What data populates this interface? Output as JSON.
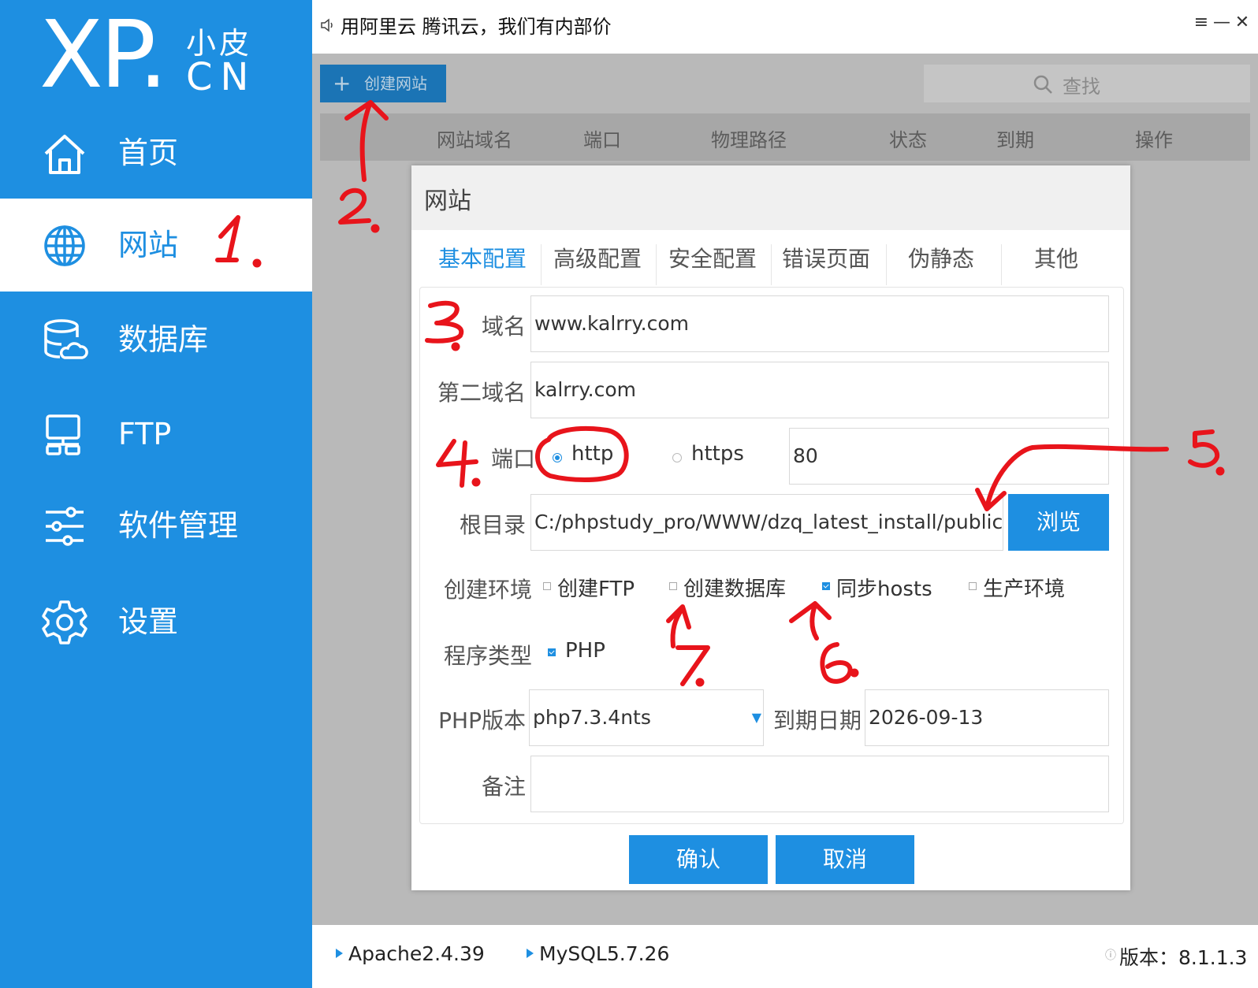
{
  "app": {
    "logo_big": "XP.",
    "logo_small_1": "小皮",
    "logo_small_2": "CN"
  },
  "sidebar": {
    "items": [
      {
        "label": "首页",
        "icon": "home-icon",
        "active": false
      },
      {
        "label": "网站",
        "icon": "globe-icon",
        "active": true
      },
      {
        "label": "数据库",
        "icon": "database-icon",
        "active": false
      },
      {
        "label": "FTP",
        "icon": "monitor-icon",
        "active": false
      },
      {
        "label": "软件管理",
        "icon": "sliders-icon",
        "active": false
      },
      {
        "label": "设置",
        "icon": "gear-icon",
        "active": false
      }
    ]
  },
  "topbar": {
    "notice": "用阿里云 腾讯云，我们有内部价",
    "menu_glyph": "≡",
    "minimize_glyph": "—",
    "close_glyph": "✕"
  },
  "toolbar": {
    "create_label": "创建网站",
    "search_label": "查找"
  },
  "table": {
    "columns": [
      "网站域名",
      "端口",
      "物理路径",
      "状态",
      "到期",
      "操作"
    ]
  },
  "dialog": {
    "title": "网站",
    "tabs": [
      "基本配置",
      "高级配置",
      "安全配置",
      "错误页面",
      "伪静态",
      "其他"
    ],
    "active_tab": "基本配置",
    "fields": {
      "domain_label": "域名",
      "domain_value": "www.kalrry.com",
      "second_domain_label": "第二域名",
      "second_domain_value": "kalrry.com",
      "port_label": "端口",
      "protocol_http": "http",
      "protocol_https": "https",
      "selected_protocol": "http",
      "port_value": "80",
      "root_label": "根目录",
      "root_value": "C:/phpstudy_pro/WWW/dzq_latest_install/public",
      "browse_label": "浏览",
      "env_label": "创建环境",
      "env_options": [
        {
          "label": "创建FTP",
          "checked": false
        },
        {
          "label": "创建数据库",
          "checked": false
        },
        {
          "label": "同步hosts",
          "checked": true
        },
        {
          "label": "生产环境",
          "checked": false
        }
      ],
      "program_type_label": "程序类型",
      "program_type_option": "PHP",
      "program_type_checked": true,
      "php_version_label": "PHP版本",
      "php_version_value": "php7.3.4nts",
      "expiry_label": "到期日期",
      "expiry_value": "2026-09-13",
      "note_label": "备注",
      "note_value": ""
    },
    "confirm_label": "确认",
    "cancel_label": "取消"
  },
  "statusbar": {
    "apache": "Apache2.4.39",
    "mysql": "MySQL5.7.26",
    "version": "版本：8.1.1.3"
  },
  "annotations": [
    "1.",
    "2.",
    "3.",
    "4.",
    "5.",
    "6.",
    "7."
  ],
  "colors": {
    "accent": "#1e8fe1",
    "annotation_red": "#e8141b",
    "main_gray": "#b9b9b9"
  }
}
